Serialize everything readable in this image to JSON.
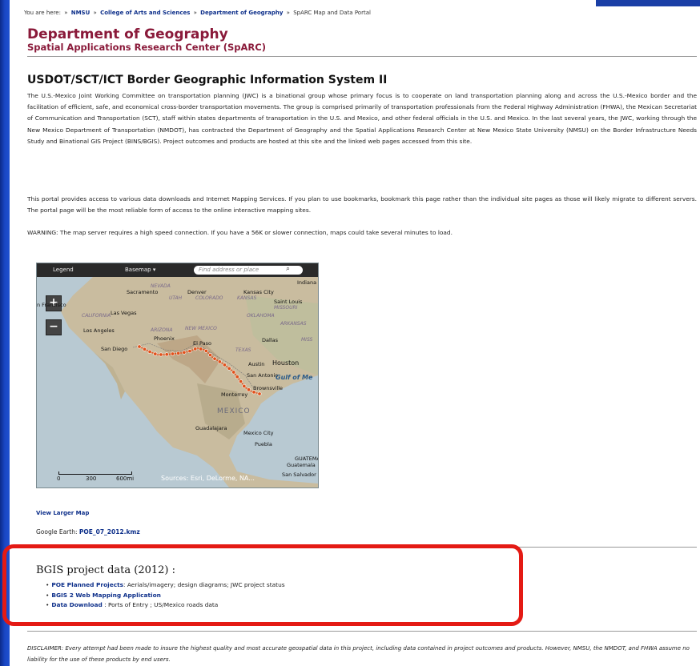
{
  "breadcrumb": {
    "prefix": "You are here:",
    "items": [
      "NMSU",
      "College of Arts and Sciences",
      "Department of Geography",
      "SpARC Map and Data Portal"
    ]
  },
  "header": {
    "title": "Department of Geography",
    "subtitle": "Spatial Applications Research Center (SpARC)"
  },
  "section_title": "USDOT/SCT/ICT Border Geographic Information System II",
  "paragraphs": [
    "The U.S.-Mexico Joint Working Committee on transportation planning (JWC) is a binational group whose primary focus is to cooperate on land transportation planning along and across the U.S.-Mexico border and the facilitation of efficient, safe, and economical cross-border transportation movements. The group is comprised primarily of transportation professionals from the Federal Highway Administration (FHWA), the Mexican Secretariat of Communication and Transportation (SCT), staff within states departments of transportation in the U.S. and Mexico, and other federal officials in the U.S. and Mexico. In the last several years, the JWC, working through the New Mexico Department of Transportation (NMDOT), has contracted the Department of Geography and the Spatial Applications Research Center at New Mexico State University (NMSU) on the Border Infrastructure Needs Study and Binational GIS Project (BINS/BGIS). Project outcomes and products are hosted at this site and the linked web pages accessed from this site.",
    "This portal provides access to various data downloads and Internet Mapping Services. If you plan to use bookmarks, bookmark this page rather than the individual site pages as those will likely migrate to different servers.  The portal page will be the most reliable form of access to the online interactive mapping sites.",
    "WARNING: The map server requires a high speed connection. If you have a 56K or slower connection, maps could take several minutes to load."
  ],
  "map": {
    "legend_label": "Legend",
    "basemap_label": "Basemap ▾",
    "search_placeholder": "Find address or place",
    "zoom_in": "+",
    "zoom_out": "−",
    "labels": {
      "nevada": "NEVADA",
      "sacramento": "Sacramento",
      "utah": "UTAH",
      "colorado": "COLORADO",
      "denver": "Denver",
      "kansas_city": "Kansas City",
      "kansas": "KANSAS",
      "indiana": "Indiana",
      "saint_louis": "Saint Louis",
      "missouri": "MISSOURI",
      "san_francisco": "n Francisco",
      "las_vegas": "Las Vegas",
      "california": "CALIFORNIA",
      "oklahoma": "OKLAHOMA",
      "arkansas": "ARKANSAS",
      "los_angeles": "Los Angeles",
      "arizona": "ARIZONA",
      "new_mexico": "NEW MEXICO",
      "phoenix": "Phoenix",
      "dallas": "Dallas",
      "san_diego": "San Diego",
      "el_paso": "El Paso",
      "texas": "TEXAS",
      "miss": "MISS",
      "austin": "Austin",
      "houston": "Houston",
      "san_antonio": "San Antonio",
      "brownsville": "Brownsville",
      "monterrey": "Monterrey",
      "gulf": "Gulf of Me",
      "mexico": "MEXICO",
      "guadalajara": "Guadalajara",
      "mexico_city": "Mexico City",
      "puebla": "Puebla",
      "guatemala_caps": "GUATEMALA",
      "guatemala": "Guatemala",
      "san_salvador": "San Salvador"
    },
    "scale_ticks": [
      "0",
      "300",
      "600mi"
    ],
    "sources": "Sources: Esri, DeLorme, NA..."
  },
  "links": {
    "view_larger_map": "View Larger Map",
    "google_earth_label": "Google Earth:",
    "google_earth_file": "POE_07_2012.kmz"
  },
  "bgis": {
    "title": "BGIS project data (2012) :",
    "items": [
      {
        "link": "POE Planned Projects",
        "text": ": Aerials/imagery; design diagrams; JWC project status"
      },
      {
        "link": "BGIS 2 Web Mapping Application",
        "text": ""
      },
      {
        "link": "Data Download",
        "text": " : Ports of Entry ; US/Mexico roads data"
      }
    ]
  },
  "disclaimer": "DISCLAIMER: Every attempt had been made to insure the highest quality and most accurate geospatial data in this project, including data contained in project outcomes and products. However, NMSU, the NMDOT, and FHWA assume no liability for the use of these products by end users.",
  "colors": {
    "brand_maroon": "#8a1a3a",
    "link_blue": "#0d2f8a",
    "highlight_red": "#e41a14",
    "route_orange": "#e0501a"
  }
}
